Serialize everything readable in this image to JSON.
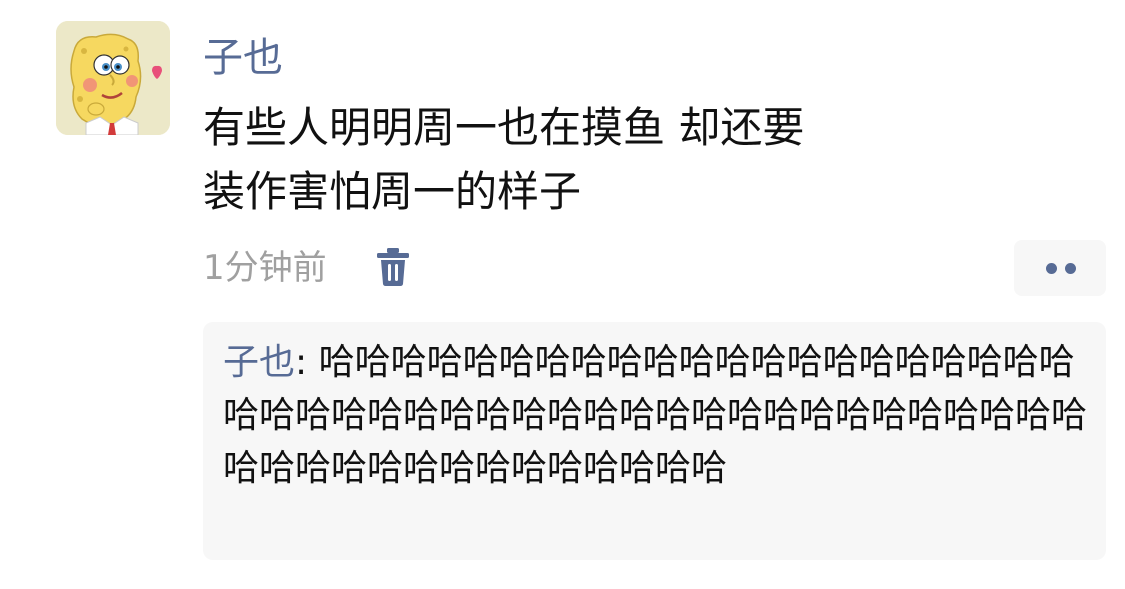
{
  "post": {
    "author": "子也",
    "avatar_icon": "spongebob-avatar",
    "text_lines": [
      "有些人明明周一也在摸鱼 却还要",
      "装作害怕周一的样子"
    ],
    "time": "1分钟前",
    "delete_icon": "trash-icon",
    "more_icon": "more-dots-icon"
  },
  "comment": {
    "author": "子也",
    "separator": ": ",
    "text": "哈哈哈哈哈哈哈哈哈哈哈哈哈哈哈哈哈哈哈哈哈哈哈哈哈哈哈哈哈哈哈哈哈哈哈哈哈哈哈哈哈哈哈哈哈哈哈哈哈哈哈哈哈哈哈哈哈哈哈"
  },
  "colors": {
    "link_blue": "#576b95",
    "comment_bg": "#f7f7f7",
    "meta_gray": "#a0a0a0"
  }
}
